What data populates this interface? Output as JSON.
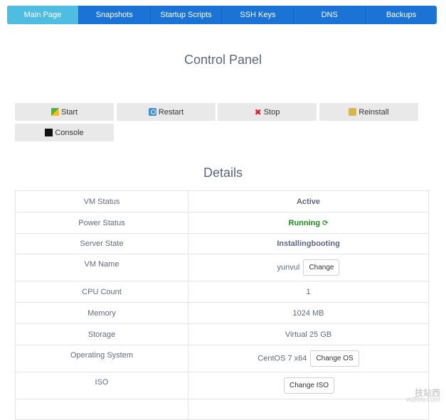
{
  "tabs": [
    {
      "label": "Main Page"
    },
    {
      "label": "Snapshots"
    },
    {
      "label": "Startup Scripts"
    },
    {
      "label": "SSH Keys"
    },
    {
      "label": "DNS"
    },
    {
      "label": "Backups"
    }
  ],
  "headings": {
    "control_panel": "Control Panel",
    "details": "Details"
  },
  "actions": {
    "start": "Start",
    "restart": "Restart",
    "stop": "Stop",
    "reinstall": "Reinstall",
    "console": "Console"
  },
  "details": {
    "vm_status": {
      "label": "VM Status",
      "value": "Active"
    },
    "power_status": {
      "label": "Power Status",
      "value": "Running"
    },
    "server_state": {
      "label": "Server State",
      "value": "Installingbooting"
    },
    "vm_name": {
      "label": "VM Name",
      "value": "yunvul",
      "button": "Change"
    },
    "cpu_count": {
      "label": "CPU Count",
      "value": "1"
    },
    "memory": {
      "label": "Memory",
      "value": "1024 MB"
    },
    "storage": {
      "label": "Storage",
      "value": "Virtual 25 GB"
    },
    "operating_system": {
      "label": "Operating System",
      "value": "CentOS 7 x64",
      "button": "Change OS"
    },
    "iso": {
      "label": "ISO",
      "button": "Change ISO"
    }
  },
  "watermark": {
    "line1": "技站西",
    "line2": "wzfou.com"
  },
  "colors": {
    "tab_bar": "#1b73d6",
    "tab_active": "#4fbde2",
    "running_green": "#1a8f1a"
  }
}
